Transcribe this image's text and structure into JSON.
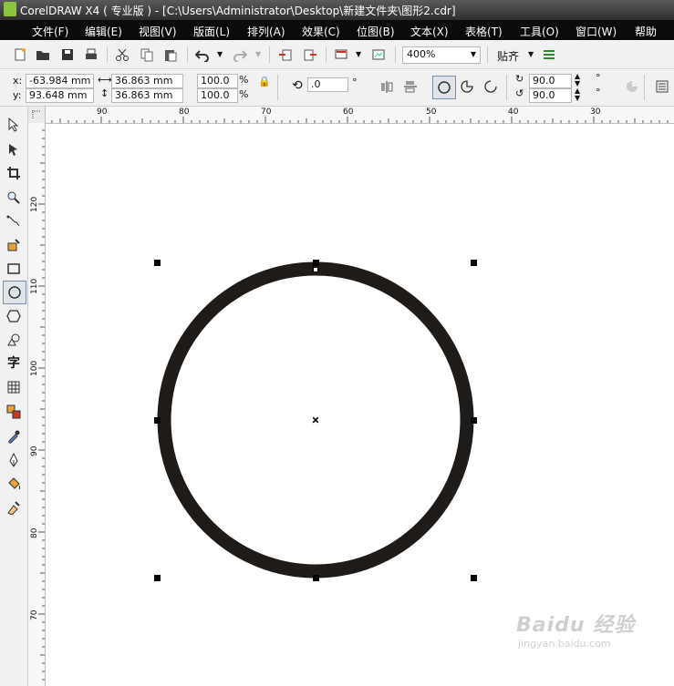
{
  "window": {
    "title": "CorelDRAW X4 ( 专业版 ) - [C:\\Users\\Administrator\\Desktop\\新建文件夹\\图形2.cdr]"
  },
  "menu": {
    "items": [
      "文件(F)",
      "编辑(E)",
      "视图(V)",
      "版面(L)",
      "排列(A)",
      "效果(C)",
      "位图(B)",
      "文本(X)",
      "表格(T)",
      "工具(O)",
      "窗口(W)",
      "帮助"
    ]
  },
  "toolbar": {
    "zoom_value": "400%",
    "snap_label": "贴齐"
  },
  "propbar": {
    "x_label": "x:",
    "y_label": "y:",
    "x_value": "-63.984 mm",
    "y_value": "93.648 mm",
    "width_value": "36.863 mm",
    "height_value": "36.863 mm",
    "scale_x": "100.0",
    "scale_y": "100.0",
    "percent": "%",
    "rotation_value": ".0",
    "degree": "°",
    "start_angle": "90.0",
    "end_angle": "90.0"
  },
  "ruler": {
    "h_labels": [
      "90",
      "80",
      "70",
      "60",
      "50",
      "40",
      "30"
    ],
    "v_labels": [
      "120",
      "110",
      "100",
      "90",
      "80",
      "70"
    ]
  },
  "watermark": {
    "brand": "Baidu 经验",
    "url": "jingyan.baidu.com"
  }
}
